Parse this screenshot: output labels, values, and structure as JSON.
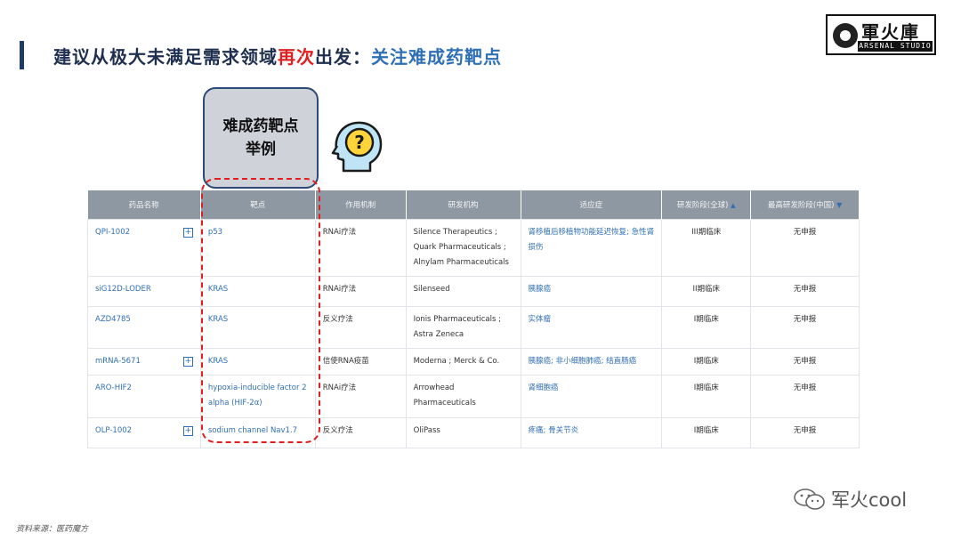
{
  "title": {
    "part1": "建议从极大未满足需求领域",
    "highlight_red": "再次",
    "part2": "出发：",
    "highlight_blue": "关注难成药靶点"
  },
  "logo": {
    "name": "軍火庫",
    "subtitle": "ARSENAL STUDIO"
  },
  "callout": {
    "line1": "难成药靶点",
    "line2": "举例"
  },
  "table": {
    "headers": [
      "药品名称",
      "靶点",
      "作用机制",
      "研发机构",
      "适应症",
      "研发阶段(全球)",
      "最高研发阶段(中国)"
    ],
    "rows": [
      {
        "drug": "QPI-1002",
        "target": "p53",
        "mech": "RNAi疗法",
        "org": "Silence Therapeutics ; Quark Pharmaceuticals ; Alnylam Pharmaceuticals",
        "ind": "肾移植后移植物功能延迟恢复; 急性肾损伤",
        "phase": "III期临床",
        "cn": "无申报"
      },
      {
        "drug": "siG12D-LODER",
        "target": "KRAS",
        "mech": "RNAi疗法",
        "org": "Silenseed",
        "ind": "胰腺癌",
        "phase": "II期临床",
        "cn": "无申报"
      },
      {
        "drug": "AZD4785",
        "target": "KRAS",
        "mech": "反义疗法",
        "org": "Ionis Pharmaceuticals ; Astra Zeneca",
        "ind": "实体瘤",
        "phase": "I期临床",
        "cn": "无申报"
      },
      {
        "drug": "mRNA-5671",
        "target": "KRAS",
        "mech": "信使RNA疫苗",
        "org": "Moderna ; Merck & Co.",
        "ind": "胰腺癌; 非小细胞肺癌; 结直肠癌",
        "phase": "I期临床",
        "cn": "无申报"
      },
      {
        "drug": "ARO-HIF2",
        "target": "hypoxia-inducible factor 2 alpha (HIF-2α)",
        "mech": "RNAi疗法",
        "org": "Arrowhead Pharmaceuticals",
        "ind": "肾细胞癌",
        "phase": "I期临床",
        "cn": "无申报"
      },
      {
        "drug": "OLP-1002",
        "target": "sodium channel Nav1.7",
        "mech": "反义疗法",
        "org": "OliPass",
        "ind": "疼痛; 骨关节炎",
        "phase": "I期临床",
        "cn": "无申报"
      }
    ]
  },
  "source": "资料来源：医药魔方",
  "watermark": "军火cool",
  "colors": {
    "accent_red": "#e02020",
    "accent_blue": "#2f6fb5",
    "header_gray": "#8e98a3",
    "title_bar": "#1f3a68"
  },
  "icons": {
    "head": "head-question-icon",
    "expand": "plus-box-icon",
    "watermark": "wechat-icon"
  }
}
